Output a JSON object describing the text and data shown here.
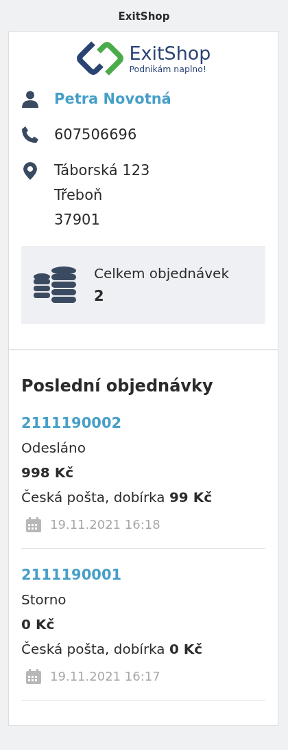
{
  "window": {
    "title": "ExitShop"
  },
  "logo": {
    "name": "ExitShop",
    "tagline": "Podnikám naplno!"
  },
  "customer": {
    "name": "Petra Novotná",
    "phone": "607506696",
    "address": [
      "Táborská 123",
      "Třeboň",
      "37901"
    ]
  },
  "stats": {
    "label": "Celkem objednávek",
    "value": "2"
  },
  "orders_heading": "Poslední objednávky",
  "orders": [
    {
      "number": "2111190002",
      "status": "Odesláno",
      "price": "998 Kč",
      "shipping": "Česká pošta, dobírka **99 Kč**",
      "date": "19.11.2021 16:18"
    },
    {
      "number": "2111190001",
      "status": "Storno",
      "price": "0 Kč",
      "shipping": "Česká pošta, dobírka **0 Kč**",
      "date": "19.11.2021 16:17"
    }
  ]
}
